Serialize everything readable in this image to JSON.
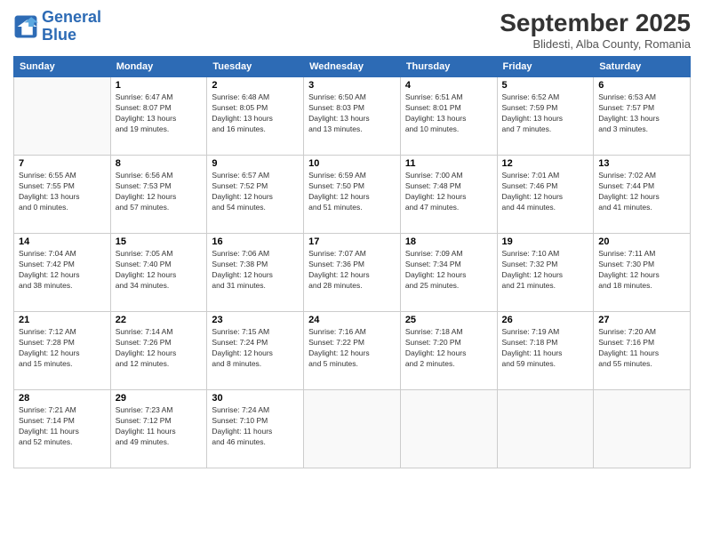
{
  "logo": {
    "line1": "General",
    "line2": "Blue"
  },
  "title": "September 2025",
  "subtitle": "Blidesti, Alba County, Romania",
  "days_of_week": [
    "Sunday",
    "Monday",
    "Tuesday",
    "Wednesday",
    "Thursday",
    "Friday",
    "Saturday"
  ],
  "weeks": [
    [
      {
        "day": "",
        "info": ""
      },
      {
        "day": "1",
        "info": "Sunrise: 6:47 AM\nSunset: 8:07 PM\nDaylight: 13 hours\nand 19 minutes."
      },
      {
        "day": "2",
        "info": "Sunrise: 6:48 AM\nSunset: 8:05 PM\nDaylight: 13 hours\nand 16 minutes."
      },
      {
        "day": "3",
        "info": "Sunrise: 6:50 AM\nSunset: 8:03 PM\nDaylight: 13 hours\nand 13 minutes."
      },
      {
        "day": "4",
        "info": "Sunrise: 6:51 AM\nSunset: 8:01 PM\nDaylight: 13 hours\nand 10 minutes."
      },
      {
        "day": "5",
        "info": "Sunrise: 6:52 AM\nSunset: 7:59 PM\nDaylight: 13 hours\nand 7 minutes."
      },
      {
        "day": "6",
        "info": "Sunrise: 6:53 AM\nSunset: 7:57 PM\nDaylight: 13 hours\nand 3 minutes."
      }
    ],
    [
      {
        "day": "7",
        "info": "Sunrise: 6:55 AM\nSunset: 7:55 PM\nDaylight: 13 hours\nand 0 minutes."
      },
      {
        "day": "8",
        "info": "Sunrise: 6:56 AM\nSunset: 7:53 PM\nDaylight: 12 hours\nand 57 minutes."
      },
      {
        "day": "9",
        "info": "Sunrise: 6:57 AM\nSunset: 7:52 PM\nDaylight: 12 hours\nand 54 minutes."
      },
      {
        "day": "10",
        "info": "Sunrise: 6:59 AM\nSunset: 7:50 PM\nDaylight: 12 hours\nand 51 minutes."
      },
      {
        "day": "11",
        "info": "Sunrise: 7:00 AM\nSunset: 7:48 PM\nDaylight: 12 hours\nand 47 minutes."
      },
      {
        "day": "12",
        "info": "Sunrise: 7:01 AM\nSunset: 7:46 PM\nDaylight: 12 hours\nand 44 minutes."
      },
      {
        "day": "13",
        "info": "Sunrise: 7:02 AM\nSunset: 7:44 PM\nDaylight: 12 hours\nand 41 minutes."
      }
    ],
    [
      {
        "day": "14",
        "info": "Sunrise: 7:04 AM\nSunset: 7:42 PM\nDaylight: 12 hours\nand 38 minutes."
      },
      {
        "day": "15",
        "info": "Sunrise: 7:05 AM\nSunset: 7:40 PM\nDaylight: 12 hours\nand 34 minutes."
      },
      {
        "day": "16",
        "info": "Sunrise: 7:06 AM\nSunset: 7:38 PM\nDaylight: 12 hours\nand 31 minutes."
      },
      {
        "day": "17",
        "info": "Sunrise: 7:07 AM\nSunset: 7:36 PM\nDaylight: 12 hours\nand 28 minutes."
      },
      {
        "day": "18",
        "info": "Sunrise: 7:09 AM\nSunset: 7:34 PM\nDaylight: 12 hours\nand 25 minutes."
      },
      {
        "day": "19",
        "info": "Sunrise: 7:10 AM\nSunset: 7:32 PM\nDaylight: 12 hours\nand 21 minutes."
      },
      {
        "day": "20",
        "info": "Sunrise: 7:11 AM\nSunset: 7:30 PM\nDaylight: 12 hours\nand 18 minutes."
      }
    ],
    [
      {
        "day": "21",
        "info": "Sunrise: 7:12 AM\nSunset: 7:28 PM\nDaylight: 12 hours\nand 15 minutes."
      },
      {
        "day": "22",
        "info": "Sunrise: 7:14 AM\nSunset: 7:26 PM\nDaylight: 12 hours\nand 12 minutes."
      },
      {
        "day": "23",
        "info": "Sunrise: 7:15 AM\nSunset: 7:24 PM\nDaylight: 12 hours\nand 8 minutes."
      },
      {
        "day": "24",
        "info": "Sunrise: 7:16 AM\nSunset: 7:22 PM\nDaylight: 12 hours\nand 5 minutes."
      },
      {
        "day": "25",
        "info": "Sunrise: 7:18 AM\nSunset: 7:20 PM\nDaylight: 12 hours\nand 2 minutes."
      },
      {
        "day": "26",
        "info": "Sunrise: 7:19 AM\nSunset: 7:18 PM\nDaylight: 11 hours\nand 59 minutes."
      },
      {
        "day": "27",
        "info": "Sunrise: 7:20 AM\nSunset: 7:16 PM\nDaylight: 11 hours\nand 55 minutes."
      }
    ],
    [
      {
        "day": "28",
        "info": "Sunrise: 7:21 AM\nSunset: 7:14 PM\nDaylight: 11 hours\nand 52 minutes."
      },
      {
        "day": "29",
        "info": "Sunrise: 7:23 AM\nSunset: 7:12 PM\nDaylight: 11 hours\nand 49 minutes."
      },
      {
        "day": "30",
        "info": "Sunrise: 7:24 AM\nSunset: 7:10 PM\nDaylight: 11 hours\nand 46 minutes."
      },
      {
        "day": "",
        "info": ""
      },
      {
        "day": "",
        "info": ""
      },
      {
        "day": "",
        "info": ""
      },
      {
        "day": "",
        "info": ""
      }
    ]
  ]
}
